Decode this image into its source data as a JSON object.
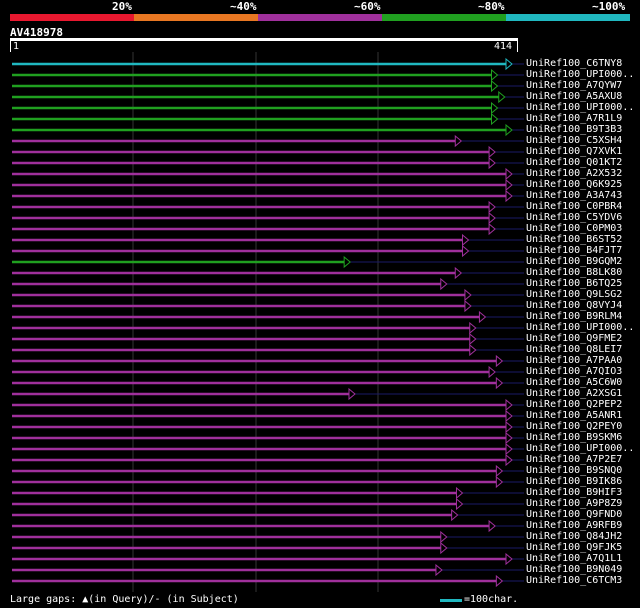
{
  "scale_labels": [
    "20%",
    "~40%",
    "~60%",
    "~80%",
    "~100%"
  ],
  "scale_colors": [
    "#e8182f",
    "#e87722",
    "#a0309c",
    "#20a020",
    "#20b8c0"
  ],
  "query": {
    "id": "AV418978",
    "start": "1",
    "end": "414"
  },
  "footer": {
    "gap_note": "Large gaps: ▲(in Query)/- (in Subject)",
    "legend_text": "=100char.",
    "legend_color": "#20b8c0"
  },
  "hits": [
    {
      "name": "UniRef100_C6TNY8",
      "end": 414,
      "band": 5
    },
    {
      "name": "UniRef100_UPI000..",
      "end": 402,
      "band": 4
    },
    {
      "name": "UniRef100_A7QYW7",
      "end": 402,
      "band": 4
    },
    {
      "name": "UniRef100_A5AXU8",
      "end": 408,
      "band": 4
    },
    {
      "name": "UniRef100_UPI000..",
      "end": 402,
      "band": 4
    },
    {
      "name": "UniRef100_A7R1L9",
      "end": 402,
      "band": 4
    },
    {
      "name": "UniRef100_B9T3B3",
      "end": 414,
      "band": 4
    },
    {
      "name": "UniRef100_C5XSH4",
      "end": 372,
      "band": 3
    },
    {
      "name": "UniRef100_Q7XVK1",
      "end": 400,
      "band": 3
    },
    {
      "name": "UniRef100_Q01KT2",
      "end": 400,
      "band": 3
    },
    {
      "name": "UniRef100_A2X532",
      "end": 414,
      "band": 3
    },
    {
      "name": "UniRef100_Q6K925",
      "end": 414,
      "band": 3
    },
    {
      "name": "UniRef100_A3A743",
      "end": 414,
      "band": 3
    },
    {
      "name": "UniRef100_C0PBR4",
      "end": 400,
      "band": 3
    },
    {
      "name": "UniRef100_C5YDV6",
      "end": 400,
      "band": 3
    },
    {
      "name": "UniRef100_C0PM03",
      "end": 400,
      "band": 3
    },
    {
      "name": "UniRef100_B6ST52",
      "end": 378,
      "band": 3
    },
    {
      "name": "UniRef100_B4FJT7",
      "end": 378,
      "band": 3
    },
    {
      "name": "UniRef100_B9GQM2",
      "end": 280,
      "band": 4
    },
    {
      "name": "UniRef100_B8LK80",
      "end": 372,
      "band": 3
    },
    {
      "name": "UniRef100_B6TQ25",
      "end": 360,
      "band": 3
    },
    {
      "name": "UniRef100_Q9LSG2",
      "end": 380,
      "band": 3
    },
    {
      "name": "UniRef100_Q8VYJ4",
      "end": 380,
      "band": 3
    },
    {
      "name": "UniRef100_B9RLM4",
      "end": 392,
      "band": 3
    },
    {
      "name": "UniRef100_UPI000..",
      "end": 384,
      "band": 3
    },
    {
      "name": "UniRef100_Q9FME2",
      "end": 384,
      "band": 3
    },
    {
      "name": "UniRef100_Q8LEI7",
      "end": 384,
      "band": 3
    },
    {
      "name": "UniRef100_A7PAA0",
      "end": 406,
      "band": 3
    },
    {
      "name": "UniRef100_A7QIO3",
      "end": 400,
      "band": 3
    },
    {
      "name": "UniRef100_A5C6W0",
      "end": 406,
      "band": 3
    },
    {
      "name": "UniRef100_A2XSG1",
      "end": 284,
      "band": 3
    },
    {
      "name": "UniRef100_Q2PEP2",
      "end": 414,
      "band": 3
    },
    {
      "name": "UniRef100_A5ANR1",
      "end": 414,
      "band": 3
    },
    {
      "name": "UniRef100_Q2PEY0",
      "end": 414,
      "band": 3
    },
    {
      "name": "UniRef100_B9SKM6",
      "end": 414,
      "band": 3
    },
    {
      "name": "UniRef100_UPI000..",
      "end": 414,
      "band": 3
    },
    {
      "name": "UniRef100_A7P2E7",
      "end": 414,
      "band": 3
    },
    {
      "name": "UniRef100_B9SNQ0",
      "end": 406,
      "band": 3
    },
    {
      "name": "UniRef100_B9IK86",
      "end": 406,
      "band": 3
    },
    {
      "name": "UniRef100_B9HIF3",
      "end": 373,
      "band": 3
    },
    {
      "name": "UniRef100_A9P8Z9",
      "end": 373,
      "band": 3
    },
    {
      "name": "UniRef100_Q9FND0",
      "end": 369,
      "band": 3
    },
    {
      "name": "UniRef100_A9RFB9",
      "end": 400,
      "band": 3
    },
    {
      "name": "UniRef100_Q84JH2",
      "end": 360,
      "band": 3
    },
    {
      "name": "UniRef100_Q9FJK5",
      "end": 360,
      "band": 3
    },
    {
      "name": "UniRef100_A7Q1L1",
      "end": 414,
      "band": 3
    },
    {
      "name": "UniRef100_B9N049",
      "end": 356,
      "band": 3
    },
    {
      "name": "UniRef100_C6TCM3",
      "end": 406,
      "band": 3
    }
  ]
}
